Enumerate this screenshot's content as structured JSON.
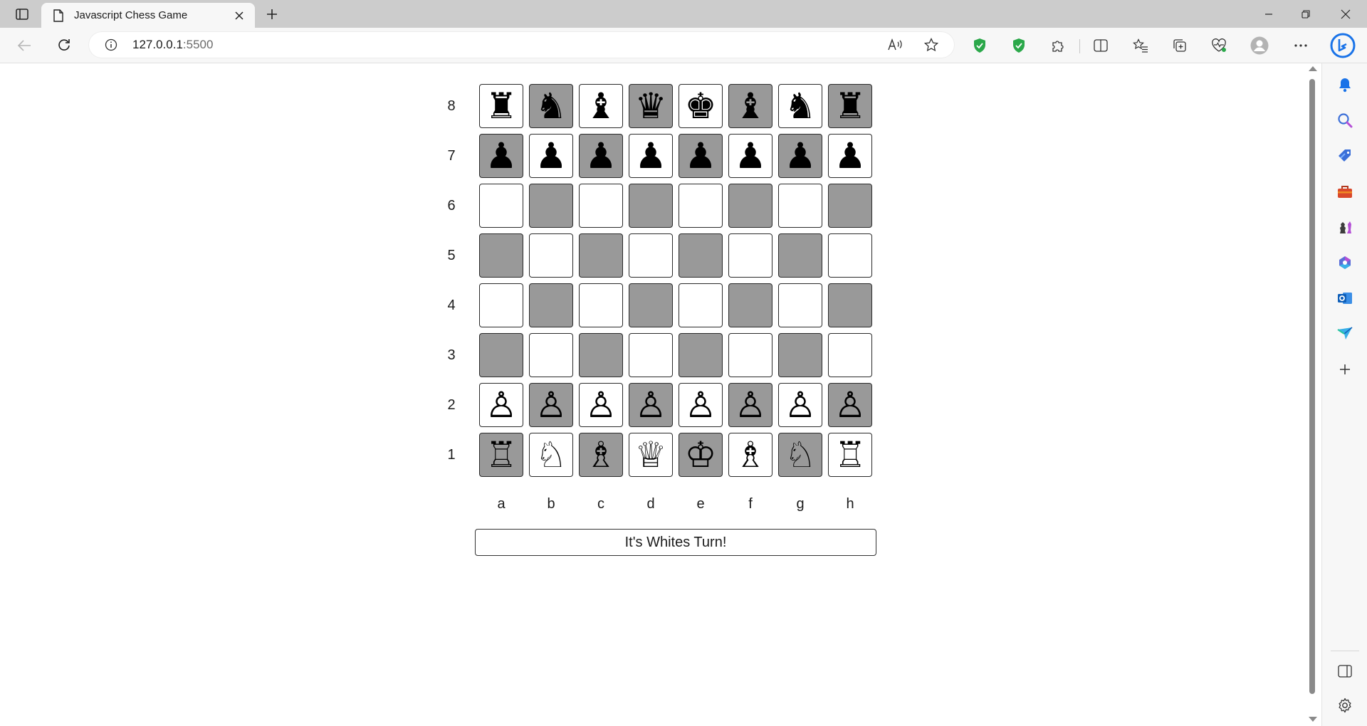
{
  "browser": {
    "tab_title": "Javascript Chess Game",
    "url_host": "127.0.0.1",
    "url_port": ":5500"
  },
  "board": {
    "ranks": [
      "8",
      "7",
      "6",
      "5",
      "4",
      "3",
      "2",
      "1"
    ],
    "files": [
      "a",
      "b",
      "c",
      "d",
      "e",
      "f",
      "g",
      "h"
    ],
    "squares": [
      [
        "♜",
        "♞",
        "♝",
        "♛",
        "♚",
        "♝",
        "♞",
        "♜"
      ],
      [
        "♟",
        "♟",
        "♟",
        "♟",
        "♟",
        "♟",
        "♟",
        "♟"
      ],
      [
        "",
        "",
        "",
        "",
        "",
        "",
        "",
        ""
      ],
      [
        "",
        "",
        "",
        "",
        "",
        "",
        "",
        ""
      ],
      [
        "",
        "",
        "",
        "",
        "",
        "",
        "",
        ""
      ],
      [
        "",
        "",
        "",
        "",
        "",
        "",
        "",
        ""
      ],
      [
        "♙",
        "♙",
        "♙",
        "♙",
        "♙",
        "♙",
        "♙",
        "♙"
      ],
      [
        "♖",
        "♘",
        "♗",
        "♕",
        "♔",
        "♗",
        "♘",
        "♖"
      ]
    ]
  },
  "status": {
    "text": "It's Whites Turn!"
  },
  "colors": {
    "light_square": "#ffffff",
    "dark_square": "#999999"
  }
}
